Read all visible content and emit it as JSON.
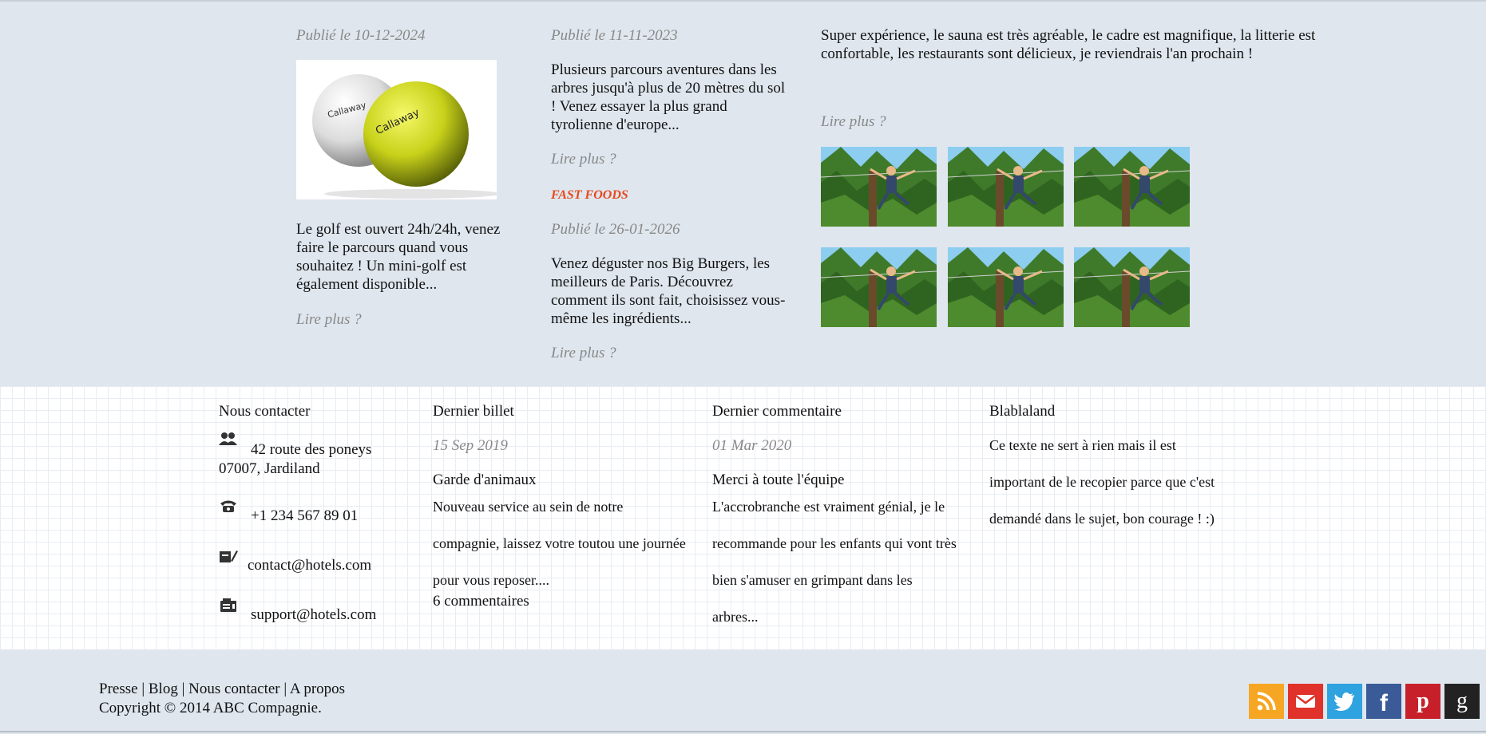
{
  "posts": {
    "golf": {
      "date": "Publié le 10-12-2024",
      "text": "Le golf est ouvert 24h/24h, venez faire le parcours quand vous souhaitez ! Un mini-golf est également disponible...",
      "read_more": "Lire plus ?",
      "image_icon": "golf-balls-image"
    },
    "accro": {
      "date": "Publié le 11-11-2023",
      "text": "Plusieurs parcours aventures dans les arbres jusqu'à plus de 20 mètres du sol ! Venez essayer la plus grand tyrolienne d'europe...",
      "read_more": "Lire plus ?"
    },
    "fastfood": {
      "category": "FAST FOODS",
      "date": "Publié le 26-01-2026",
      "text": "Venez déguster nos Big Burgers, les meilleurs de Paris. Découvrez comment ils sont fait, choisissez vous-même les ingrédients...",
      "read_more": "Lire plus ?"
    },
    "review": {
      "text": "Super expérience, le sauna est très agréable, le cadre est magnifique, la litterie est confortable, les restaurants sont délicieux, je reviendrais l'an prochain !",
      "read_more": "Lire plus ?"
    }
  },
  "footer": {
    "contact": {
      "title": "Nous contacter",
      "address_line1": "42 route des poneys",
      "address_line2": "07007, Jardiland",
      "phone": "+1 234 567 89 01",
      "email": "contact@hotels.com",
      "support": "support@hotels.com"
    },
    "last_post": {
      "title": "Dernier billet",
      "date": "15 Sep 2019",
      "headline": "Garde d'animaux",
      "text": "Nouveau service au sein de notre compagnie, laissez votre toutou une journée pour vous reposer....",
      "comments": "6 commentaires"
    },
    "last_comment": {
      "title": "Dernier commentaire",
      "date": "01 Mar 2020",
      "headline": "Merci à toute l'équipe",
      "text": "L'accrobranche est vraiment génial, je le recommande pour les enfants qui vont très bien s'amuser en grimpant dans les arbres..."
    },
    "blabla": {
      "title": "Blablaland",
      "text": "Ce texte ne sert à rien mais il est important de le recopier parce que c'est demandé dans le sujet, bon courage ! :)"
    }
  },
  "bottom": {
    "links": [
      {
        "label": "Presse"
      },
      {
        "label": "Blog"
      },
      {
        "label": "Nous contacter"
      },
      {
        "label": "A propos"
      }
    ],
    "separator": "|",
    "copyright": "Copyright © 2014 ABC Compagnie.",
    "social": [
      {
        "name": "rss-icon",
        "color": "#f6a623",
        "glyph": ""
      },
      {
        "name": "mail-icon",
        "color": "#e0322a",
        "glyph": ""
      },
      {
        "name": "twitter-icon",
        "color": "#2fa2e0",
        "glyph": ""
      },
      {
        "name": "facebook-icon",
        "color": "#3a5a98",
        "glyph": "f"
      },
      {
        "name": "pinterest-icon",
        "color": "#c8202a",
        "glyph": "p"
      },
      {
        "name": "google-icon",
        "color": "#222222",
        "glyph": "g"
      }
    ]
  }
}
